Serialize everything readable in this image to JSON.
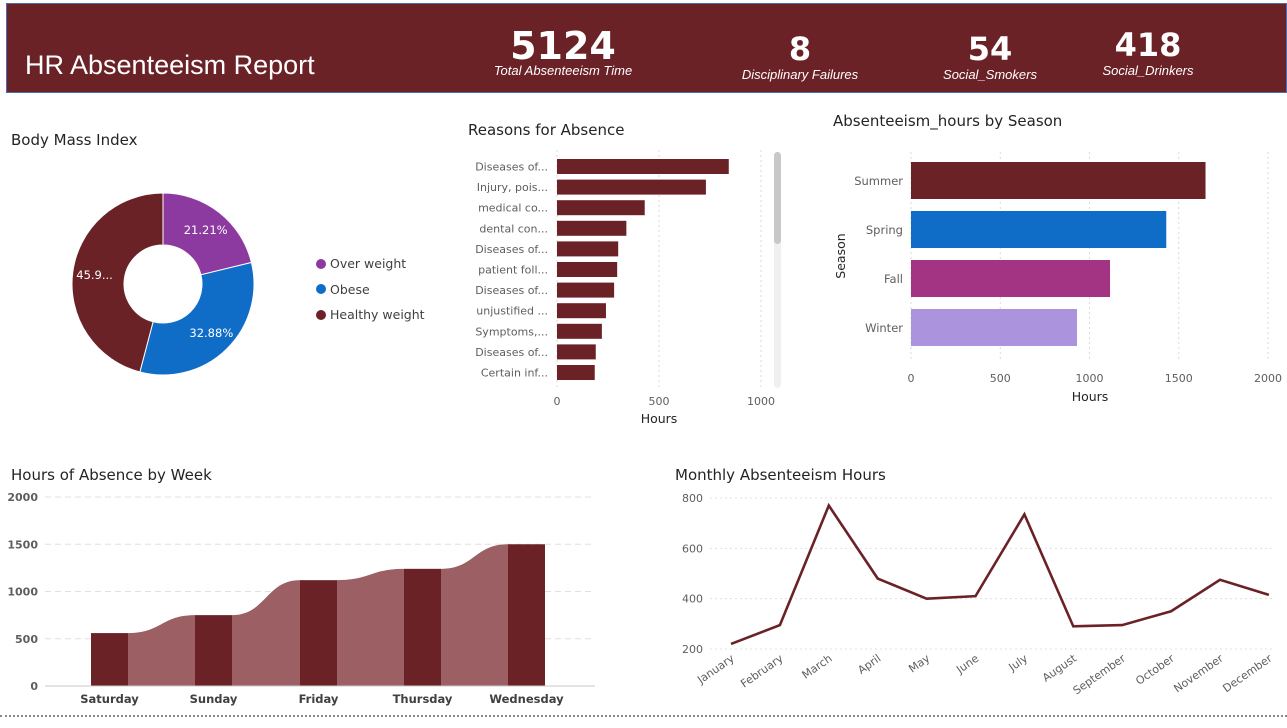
{
  "header": {
    "title": "HR Absenteeism Report",
    "kpis": [
      {
        "value": "5124",
        "label": "Total Absenteeism Time"
      },
      {
        "value": "8",
        "label": "Disciplinary Failures"
      },
      {
        "value": "54",
        "label": "Social_Smokers"
      },
      {
        "value": "418",
        "label": "Social_Drinkers"
      }
    ]
  },
  "colors": {
    "header_bg": "#6b2227",
    "maroon": "#6b2227",
    "area_fill": "#9c6064",
    "purple": "#8c3aa0",
    "blue": "#0f6cc7",
    "magenta": "#a33383",
    "lavender": "#ab93dd"
  },
  "bmi": {
    "title": "Body Mass Index",
    "slice_labels": [
      "21.21%",
      "32.88%",
      "45.9..."
    ],
    "legend": [
      {
        "label": "Over weight",
        "color": "#8c3aa0"
      },
      {
        "label": "Obese",
        "color": "#0f6cc7"
      },
      {
        "label": "Healthy weight",
        "color": "#6b2227"
      }
    ]
  },
  "reasons": {
    "title": "Reasons for Absence",
    "xlabel": "Hours"
  },
  "season": {
    "title": "Absenteeism_hours by Season",
    "xlabel": "Hours",
    "ylabel": "Season"
  },
  "week": {
    "title": "Hours of Absence by Week"
  },
  "monthly": {
    "title": "Monthly Absenteeism Hours"
  },
  "chart_data": [
    {
      "type": "pie",
      "title": "Body Mass Index",
      "categories": [
        "Over weight",
        "Obese",
        "Healthy weight"
      ],
      "values": [
        21.21,
        32.88,
        45.91
      ],
      "colors": [
        "#8c3aa0",
        "#0f6cc7",
        "#6b2227"
      ],
      "donut": true,
      "legend": "right"
    },
    {
      "type": "bar",
      "orientation": "horizontal",
      "title": "Reasons for Absence",
      "categories": [
        "Diseases of...",
        "Injury, pois...",
        "medical co...",
        "dental con...",
        "Diseases of...",
        "patient foll...",
        "Diseases of...",
        "unjustified ...",
        "Symptoms,...",
        "Diseases of...",
        "Certain inf..."
      ],
      "values": [
        842,
        730,
        430,
        340,
        300,
        295,
        280,
        240,
        220,
        190,
        185
      ],
      "xlabel": "Hours",
      "xlim": [
        0,
        1000
      ],
      "xticks": [
        0,
        500,
        1000
      ],
      "color": "#6b2227",
      "grid": true
    },
    {
      "type": "bar",
      "orientation": "horizontal",
      "title": "Absenteeism_hours by Season",
      "categories": [
        "Summer",
        "Spring",
        "Fall",
        "Winter"
      ],
      "values": [
        1650,
        1430,
        1115,
        930
      ],
      "colors": [
        "#6b2227",
        "#0f6cc7",
        "#a33383",
        "#ab93dd"
      ],
      "xlabel": "Hours",
      "ylabel": "Season",
      "xlim": [
        0,
        2000
      ],
      "xticks": [
        0,
        500,
        1000,
        1500,
        2000
      ],
      "grid": true
    },
    {
      "type": "bar",
      "title": "Hours of Absence by Week",
      "categories": [
        "Saturday",
        "Sunday",
        "Friday",
        "Thursday",
        "Wednesday"
      ],
      "values": [
        560,
        750,
        1120,
        1240,
        1500
      ],
      "ylim": [
        0,
        2000
      ],
      "yticks": [
        0,
        500,
        1000,
        1500,
        2000
      ],
      "style": "ribbon",
      "color": "#6b2227",
      "grid": true
    },
    {
      "type": "line",
      "title": "Monthly Absenteeism Hours",
      "categories": [
        "January",
        "February",
        "March",
        "April",
        "May",
        "June",
        "July",
        "August",
        "September",
        "October",
        "November",
        "December"
      ],
      "values": [
        220,
        295,
        770,
        480,
        400,
        410,
        735,
        290,
        295,
        350,
        475,
        415
      ],
      "ylim": [
        200,
        800
      ],
      "yticks": [
        200,
        400,
        600,
        800
      ],
      "color": "#6b2227",
      "grid": true
    }
  ]
}
